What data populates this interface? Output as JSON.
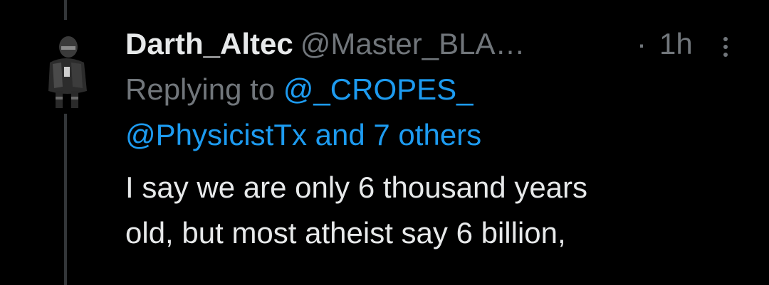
{
  "tweet": {
    "author": {
      "display_name": "Darth_Altec",
      "handle": "@Master_BLA…",
      "avatar_icon": "armored-soldier-avatar-icon"
    },
    "separator": "·",
    "timestamp": "1h",
    "more_icon": "more-vertical-icon",
    "reply": {
      "prefix": "Replying to ",
      "mention_primary": "@_CROPES_",
      "mention_secondary": "@PhysicistTx and 7 others"
    },
    "text_lines": [
      "I say we are only 6 thousand years",
      "old, but most atheist say 6 billion,"
    ]
  },
  "colors": {
    "background": "#000000",
    "primary_text": "#e7e9ea",
    "secondary_text": "#71767b",
    "link": "#1d9bf0",
    "thread_line": "#333639"
  }
}
